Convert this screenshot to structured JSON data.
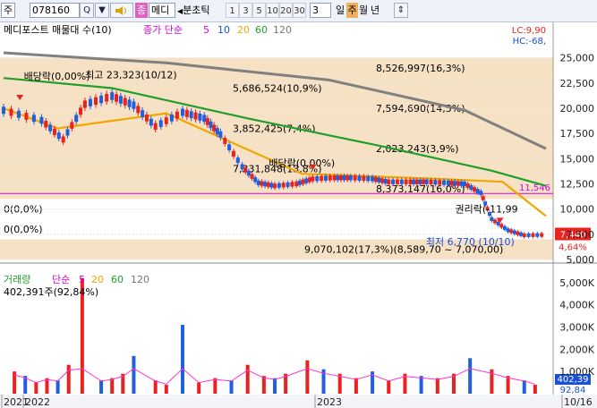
{
  "toolbar": {
    "market_label": "주",
    "code_value": "078160",
    "search_button": "Q",
    "menu_arrow": "▼",
    "tag_label": "종",
    "name_label": "메디",
    "tick_label": "분초틱",
    "periods": [
      "1",
      "3",
      "5",
      "10",
      "20",
      "30"
    ],
    "count_value": "3",
    "day_label": "일",
    "week_label": "주",
    "month_label": "월",
    "year_label": "년",
    "sync_icon": "⇕"
  },
  "legend": {
    "price_main": "메디포스트 매물대 수(10)",
    "ma_label": "종가 단순",
    "ma_periods": [
      "5",
      "10",
      "20",
      "60",
      "120"
    ],
    "volume_main": "거래량",
    "volume_ma_label": "단순",
    "volume_ma_periods": [
      "5",
      "20",
      "60",
      "120"
    ],
    "volume_info": "402,391주(92,84%)"
  },
  "header_right": {
    "lc": "LC:9,90",
    "hc": "HC:-68,"
  },
  "colors": {
    "up": "#e8231f",
    "down": "#1f5fe0",
    "ma5": "#ff33cc",
    "ma10": "#1a4fd8",
    "ma20": "#f0a800",
    "ma60": "#1fa02a",
    "ma120": "#808080",
    "profile": "#f7e1c4",
    "magenta": "#e000e0"
  },
  "chart_data": {
    "type": "candlestick",
    "x_labels": [
      "2021",
      "2022",
      "2023",
      "10/16"
    ],
    "price_axis_ticks": [
      5000,
      7500,
      10000,
      12500,
      15000,
      17500,
      20000,
      22500,
      25000
    ],
    "price_axis_labels": [
      "5,000",
      "7,500",
      "10,000",
      "12,500",
      "15,000",
      "17,500",
      "20,000",
      "22,500",
      "25,000"
    ],
    "ylim": [
      5000,
      26300
    ],
    "volume_axis_ticks": [
      1000000,
      2000000,
      3000000,
      4000000,
      5000000
    ],
    "volume_axis_labels": [
      "1,000K",
      "2,000K",
      "3,000K",
      "4,000K",
      "5,000K"
    ],
    "volume_ylim": [
      0,
      5400000
    ],
    "volume_profile": [
      {
        "low": 23000,
        "high": 25000,
        "label": "8,526,997(16,3%)"
      },
      {
        "low": 21000,
        "high": 23000,
        "label": "5,686,524(10,9%)"
      },
      {
        "low": 19000,
        "high": 21000,
        "label": "7,594,690(14,5%)"
      },
      {
        "low": 17000,
        "high": 19000,
        "label": "3,852,425(7,4%)"
      },
      {
        "low": 15000,
        "high": 17000,
        "label": "2,023,243(3,9%)"
      },
      {
        "low": 13000,
        "high": 15000,
        "label": "7,231,848(13,8%)"
      },
      {
        "low": 11000,
        "high": 13000,
        "label": "8,373,147(16,0%)"
      },
      {
        "low": 9000,
        "high": 11000,
        "label": "0(0,0%)"
      },
      {
        "low": 7000,
        "high": 9000,
        "label": "0(0,0%)"
      },
      {
        "low": 5000,
        "high": 7000,
        "label": "9,070,102(17,3%)(8,589,70 ~ 7,070,00)"
      }
    ],
    "annotations": [
      {
        "text": "최고 23,323(10/12)",
        "x": 0.2,
        "y": 23323
      },
      {
        "text": "배당락(0,00%)",
        "x": 0.1,
        "y": 23200
      },
      {
        "text": "배당락(0,00%)",
        "x": 0.555,
        "y": 14600
      },
      {
        "text": "권리락(-11,99",
        "x": 0.915,
        "y": 10000
      },
      {
        "text": "최저 6,770 (10/10)",
        "x": 0.975,
        "y": 6770
      }
    ],
    "horizontal_level": {
      "value": 11546,
      "label": "11,546"
    },
    "last_price": {
      "value": 7440,
      "label": "7,440",
      "change": "4,64%"
    },
    "last_volume": {
      "label": "402,39",
      "pct": "92,84"
    },
    "price_points": [
      [
        0,
        19800,
        20500
      ],
      [
        0.07,
        18800,
        18400
      ],
      [
        0.11,
        16900,
        15800
      ],
      [
        0.15,
        20400,
        20800
      ],
      [
        0.2,
        21200,
        21800
      ],
      [
        0.24,
        20300,
        19600
      ],
      [
        0.28,
        18200,
        17500
      ],
      [
        0.33,
        19600,
        19700
      ],
      [
        0.37,
        19000,
        19600
      ],
      [
        0.4,
        17400,
        17900
      ],
      [
        0.44,
        14200,
        15000
      ],
      [
        0.47,
        12600,
        13900
      ],
      [
        0.5,
        12300,
        12900
      ],
      [
        0.54,
        12500,
        12800
      ],
      [
        0.57,
        13000,
        12900
      ],
      [
        0.61,
        13100,
        13100
      ],
      [
        0.64,
        13100,
        13200
      ],
      [
        0.68,
        13000,
        13200
      ],
      [
        0.71,
        12700,
        13100
      ],
      [
        0.75,
        12700,
        12900
      ],
      [
        0.78,
        12700,
        12900
      ],
      [
        0.82,
        12600,
        12600
      ],
      [
        0.85,
        12500,
        12500
      ],
      [
        0.88,
        11600,
        12300
      ],
      [
        0.9,
        9000,
        12000
      ],
      [
        0.93,
        7900,
        11800
      ],
      [
        0.96,
        7400,
        11400
      ],
      [
        1,
        7440,
        10100
      ]
    ],
    "ma_series": [
      {
        "name": "120",
        "values": [
          [
            0,
            25500
          ],
          [
            0.3,
            24500
          ],
          [
            0.6,
            22800
          ],
          [
            0.85,
            19800
          ],
          [
            1,
            16000
          ]
        ]
      },
      {
        "name": "60",
        "values": [
          [
            0,
            23000
          ],
          [
            0.2,
            22000
          ],
          [
            0.45,
            19000
          ],
          [
            0.7,
            16200
          ],
          [
            0.9,
            13800
          ],
          [
            1,
            12300
          ]
        ]
      },
      {
        "name": "20",
        "values": [
          [
            0,
            20000
          ],
          [
            0.1,
            18000
          ],
          [
            0.3,
            19500
          ],
          [
            0.55,
            13500
          ],
          [
            0.8,
            13000
          ],
          [
            0.92,
            12700
          ],
          [
            1,
            9300
          ]
        ]
      }
    ],
    "volume_points": [
      [
        0.02,
        1000000
      ],
      [
        0.04,
        800000
      ],
      [
        0.06,
        500000
      ],
      [
        0.08,
        700000
      ],
      [
        0.1,
        600000
      ],
      [
        0.12,
        1300000
      ],
      [
        0.145,
        5200000
      ],
      [
        0.18,
        600000
      ],
      [
        0.2,
        700000
      ],
      [
        0.22,
        900000
      ],
      [
        0.24,
        1700000
      ],
      [
        0.28,
        600000
      ],
      [
        0.3,
        400000
      ],
      [
        0.33,
        3100000
      ],
      [
        0.36,
        500000
      ],
      [
        0.39,
        700000
      ],
      [
        0.42,
        600000
      ],
      [
        0.45,
        1300000
      ],
      [
        0.48,
        800000
      ],
      [
        0.5,
        700000
      ],
      [
        0.52,
        900000
      ],
      [
        0.56,
        1500000
      ],
      [
        0.59,
        1100000
      ],
      [
        0.62,
        900000
      ],
      [
        0.65,
        700000
      ],
      [
        0.68,
        1000000
      ],
      [
        0.71,
        600000
      ],
      [
        0.74,
        900000
      ],
      [
        0.77,
        800000
      ],
      [
        0.8,
        700000
      ],
      [
        0.83,
        900000
      ],
      [
        0.86,
        1600000
      ],
      [
        0.9,
        1100000
      ],
      [
        0.93,
        800000
      ],
      [
        0.96,
        600000
      ],
      [
        0.98,
        402391
      ]
    ]
  }
}
